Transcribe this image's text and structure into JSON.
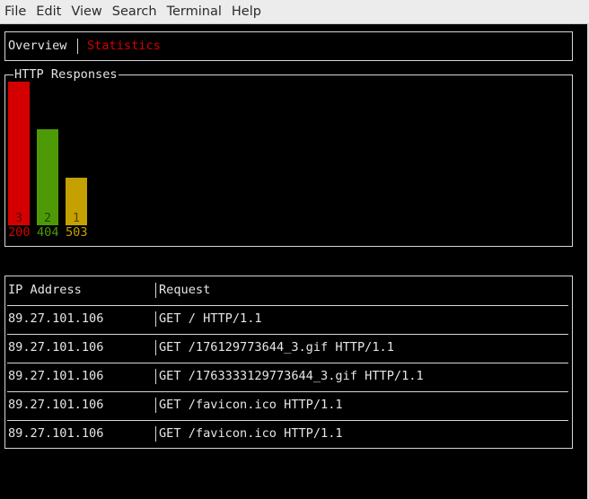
{
  "menu": [
    "File",
    "Edit",
    "View",
    "Search",
    "Terminal",
    "Help"
  ],
  "tabs": [
    {
      "label": "Overview",
      "active": false
    },
    {
      "label": "Statistics",
      "active": true
    }
  ],
  "chart_data": {
    "type": "bar",
    "title": "HTTP Responses",
    "categories": [
      "200",
      "404",
      "503"
    ],
    "values": [
      3,
      2,
      1
    ],
    "colors": [
      "#d40000",
      "#4e9a06",
      "#c4a000"
    ],
    "ylim": [
      0,
      3
    ]
  },
  "table": {
    "headers": [
      "IP Address",
      "Request"
    ],
    "rows": [
      [
        "89.27.101.106",
        "GET / HTTP/1.1"
      ],
      [
        "89.27.101.106",
        "GET /176129773644_3.gif HTTP/1.1"
      ],
      [
        "89.27.101.106",
        "GET /1763333129773644_3.gif HTTP/1.1"
      ],
      [
        "89.27.101.106",
        "GET /favicon.ico HTTP/1.1"
      ],
      [
        "89.27.101.106",
        "GET /favicon.ico HTTP/1.1"
      ]
    ]
  }
}
